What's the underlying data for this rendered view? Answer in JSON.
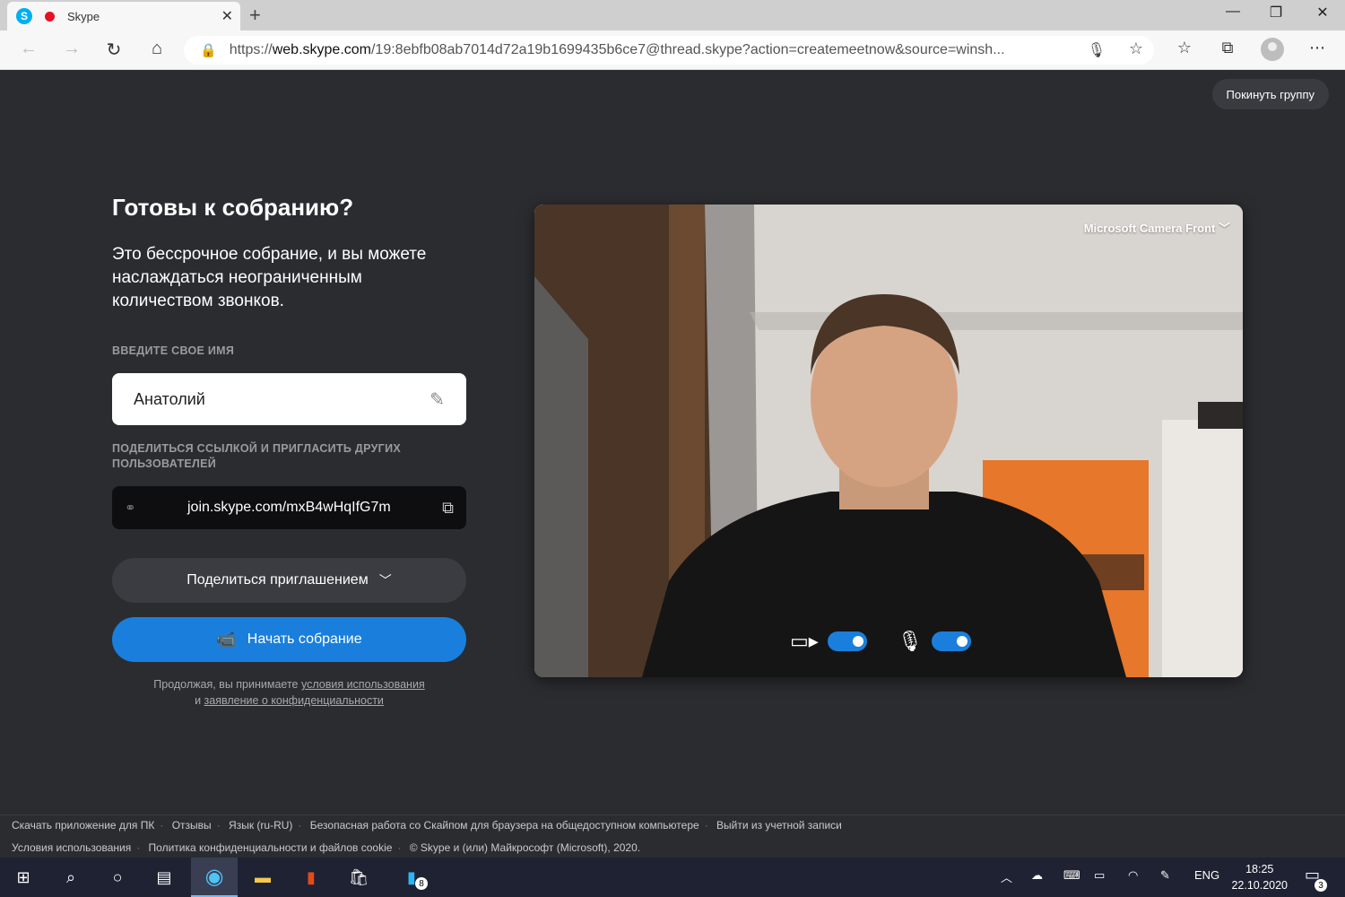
{
  "browser": {
    "tab_title": "Skype",
    "url_prefix": "https://",
    "url_host": "web.skype.com",
    "url_rest": "/19:8ebfb08ab7014d72a19b1699435b6ce7@thread.skype?action=createmeetnow&source=winsh..."
  },
  "page": {
    "leave_group": "Покинуть группу",
    "title": "Готовы к собранию?",
    "description": "Это бессрочное собрание, и вы можете наслаждаться неограниченным количеством звонков.",
    "name_label": "ВВЕДИТЕ СВОЕ ИМЯ",
    "name_value": "Анатолий",
    "share_label": "ПОДЕЛИТЬСЯ ССЫЛКОЙ И ПРИГЛАСИТЬ ДРУГИХ ПОЛЬЗОВАТЕЛЕЙ",
    "share_link": "join.skype.com/mxB4wHqIfG7m",
    "share_invite_button": "Поделиться приглашением",
    "start_meeting_button": "Начать собрание",
    "terms_prefix": "Продолжая, вы принимаете",
    "terms_link": "условия использования",
    "terms_and": "и",
    "privacy_link": "заявление о конфиденциальности"
  },
  "video": {
    "camera_name": "Microsoft Camera Front",
    "camera_on": true,
    "mic_on": true
  },
  "footer": {
    "row1": [
      "Скачать приложение для ПК",
      "Отзывы",
      "Язык (ru-RU)",
      "Безопасная работа со Скайпом для браузера на общедоступном компьютере",
      "Выйти из учетной записи"
    ],
    "row2": [
      "Условия использования",
      "Политика конфиденциальности и файлов cookie",
      "© Skype и (или) Майкрософт (Microsoft), 2020."
    ]
  },
  "taskbar": {
    "store_badge": "8",
    "lang": "ENG",
    "time": "18:25",
    "date": "22.10.2020",
    "notif_badge": "3"
  }
}
